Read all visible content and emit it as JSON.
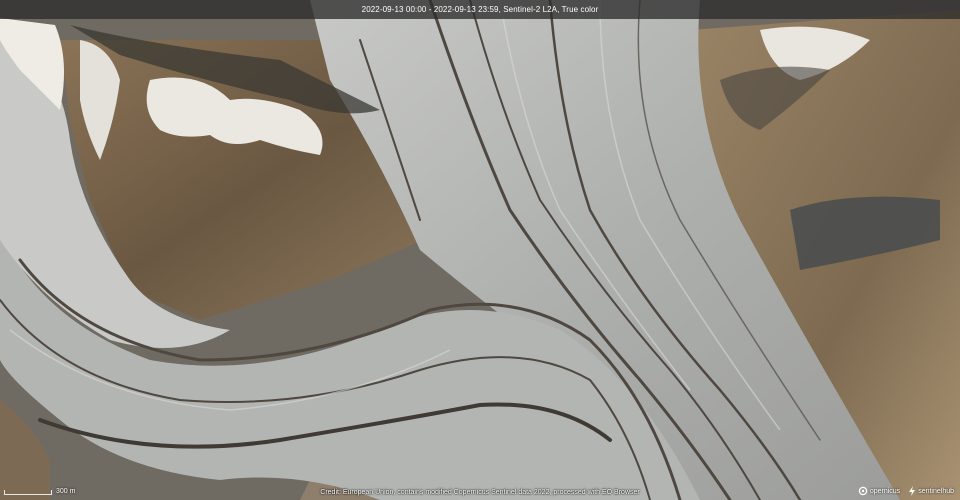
{
  "header": {
    "caption": "2022-09-13 00:00 - 2022-09-13 23:59, Sentinel-2 L2A, True color"
  },
  "scale": {
    "label": "300 m"
  },
  "footer": {
    "credit": "Credit: European Union, contains modified Copernicus Sentinel data 2022, processed with EO Browser"
  },
  "logos": {
    "copernicus": "opernicus",
    "sentinelhub": "sentinelhub"
  },
  "colors": {
    "ice": "#b9bab6",
    "rock": "#7a654c",
    "snow": "#e9e6df",
    "moraine": "#4e4840"
  }
}
